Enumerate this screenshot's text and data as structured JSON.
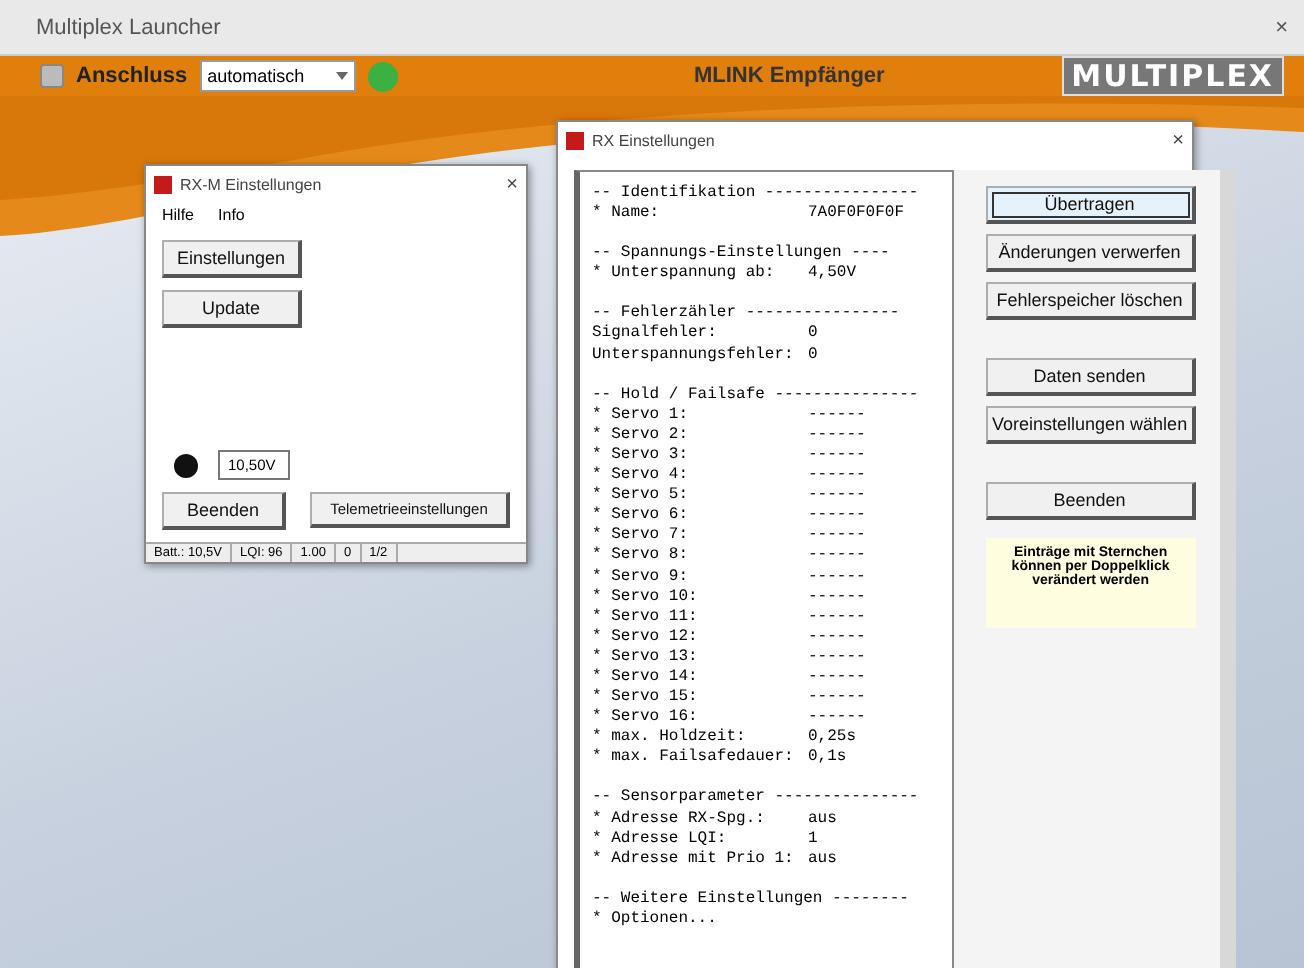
{
  "window": {
    "title": "Multiplex Launcher",
    "close": "×"
  },
  "toolbar": {
    "port_label": "Anschluss",
    "port_value": "automatisch",
    "center_title": "MLINK Empfänger",
    "logo": "MULTIPLEX"
  },
  "small_window": {
    "title": "RX-M Einstellungen",
    "close": "×",
    "menu": [
      "Hilfe",
      "Info"
    ],
    "buttons": [
      "Einstellungen",
      "Update"
    ],
    "voltage": "10,50V",
    "bottom_buttons": [
      "Beenden",
      "Telemetrieeinstellungen"
    ],
    "status_bar": [
      "Batt.: 10,5V",
      "LQI: 96",
      "1.00",
      "0",
      "1/2"
    ]
  },
  "rx_window": {
    "title": "RX Einstellungen",
    "close": "×",
    "sections": [
      {
        "header": "-- Identifikation ----------------",
        "entries": [
          {
            "label": "* Name:",
            "value": "7A0F0F0F0F"
          }
        ]
      },
      {
        "header": "-- Spannungs-Einstellungen ----",
        "entries": [
          {
            "label": "* Unterspannung ab:",
            "value": "4,50V"
          }
        ]
      },
      {
        "header": "-- Fehlerzähler ----------------",
        "entries": [
          {
            "label": "Signalfehler:",
            "value": "0"
          },
          {
            "label": "Unterspannungsfehler:",
            "value": "0"
          }
        ]
      },
      {
        "header": "-- Hold / Failsafe ---------------",
        "entries": [
          {
            "label": "* Servo 1:",
            "value": "------"
          },
          {
            "label": "* Servo 2:",
            "value": "------"
          },
          {
            "label": "* Servo 3:",
            "value": "------"
          },
          {
            "label": "* Servo 4:",
            "value": "------"
          },
          {
            "label": "* Servo 5:",
            "value": "------"
          },
          {
            "label": "* Servo 6:",
            "value": "------"
          },
          {
            "label": "* Servo 7:",
            "value": "------"
          },
          {
            "label": "* Servo 8:",
            "value": "------"
          },
          {
            "label": "* Servo 9:",
            "value": "------"
          },
          {
            "label": "* Servo 10:",
            "value": "------"
          },
          {
            "label": "* Servo 11:",
            "value": "------"
          },
          {
            "label": "* Servo 12:",
            "value": "------"
          },
          {
            "label": "* Servo 13:",
            "value": "------"
          },
          {
            "label": "* Servo 14:",
            "value": "------"
          },
          {
            "label": "* Servo 15:",
            "value": "------"
          },
          {
            "label": "* Servo 16:",
            "value": "------"
          },
          {
            "label": "* max. Holdzeit:",
            "value": "0,25s"
          },
          {
            "label": "* max. Failsafedauer:",
            "value": "0,1s"
          }
        ]
      },
      {
        "header": "-- Sensorparameter ---------------",
        "entries": [
          {
            "label": "* Adresse RX-Spg.:",
            "value": "aus"
          },
          {
            "label": "* Adresse LQI:",
            "value": "1"
          },
          {
            "label": "* Adresse mit Prio 1:",
            "value": "aus"
          }
        ]
      },
      {
        "header": "-- Weitere Einstellungen --------",
        "entries": [
          {
            "label": "* Optionen..."
          }
        ]
      }
    ],
    "button_groups": [
      [
        {
          "label": "Übertragen",
          "selected": true
        },
        {
          "label": "Änderungen verwerfen",
          "selected": false
        },
        {
          "label": "Fehlerspeicher löschen",
          "selected": false
        }
      ],
      [
        {
          "label": "Daten senden",
          "selected": false
        },
        {
          "label": "Voreinstellungen wählen",
          "selected": false
        }
      ],
      [
        {
          "label": "Beenden",
          "selected": false
        }
      ]
    ],
    "note": "Einträge mit Sternchen können per Doppelklick verändert werden"
  }
}
